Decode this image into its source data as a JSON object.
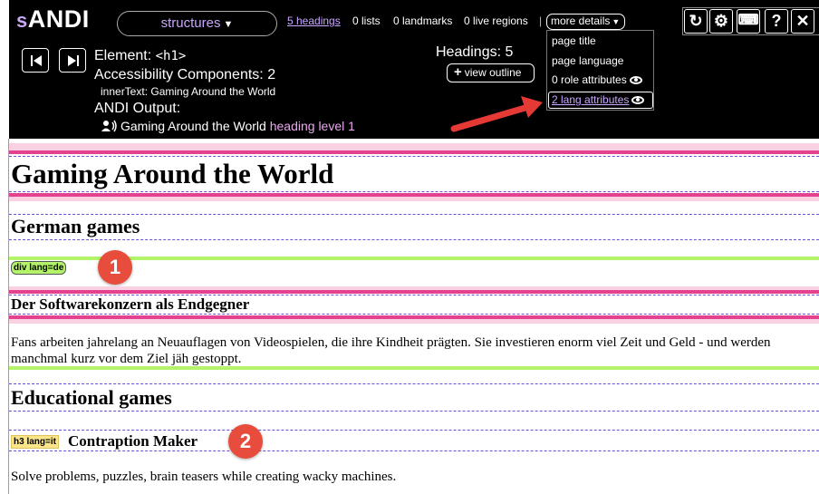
{
  "toolbar": {
    "logo_s": "s",
    "logo_rest": "ANDI",
    "mode": "structures",
    "headings_link": "5 headings",
    "lists": "0 lists",
    "landmarks": "0 landmarks",
    "live_regions": "0 live regions",
    "separator": "|",
    "more_details": "more details",
    "dropdown": {
      "page_title": "page title",
      "page_language": "page language",
      "role_attributes": "0 role attributes",
      "lang_attributes": "2 lang attributes"
    },
    "buttons": {
      "refresh": "↻",
      "settings": "⚙",
      "keyboard": "⌨",
      "help": "?",
      "close": "✕"
    },
    "element_label": "Element:",
    "element_tag": "<h1>",
    "components": "Accessibility Components: 2",
    "inner_text": "innerText: Gaming Around the World",
    "andi_output_label": "ANDI Output:",
    "output_text": "Gaming Around the World",
    "output_level": "heading level 1",
    "headings_count": "Headings: 5",
    "view_outline": "view outline",
    "plus": "+"
  },
  "content": {
    "h1": "Gaming Around the World",
    "h2_german": "German games",
    "div_lang_tag": "div lang=de",
    "h3_german": "Der Softwarekonzern als Endgegner",
    "para_german": "Fans arbeiten jahrelang an Neuauflagen von Videospielen, die ihre Kindheit prägten. Sie investieren enorm viel Zeit und Geld - und werden manchmal kurz vor dem Ziel jäh gestoppt.",
    "h2_educational": "Educational games",
    "h3_lang_tag": "h3 lang=it",
    "h3_contraption": "Contraption Maker",
    "para_contraption": "Solve problems, puzzles, brain teasers while creating wacky machines."
  },
  "annotations": {
    "badge_1": "1",
    "badge_2": "2"
  },
  "colors": {
    "toolbar_bg": "#000000",
    "link_purple": "#c8a6ff",
    "heading_pink": "#e4418f",
    "lang_green": "#b3f46a",
    "lang_yellow": "#fbe58a",
    "badge_red": "#e74c3c"
  }
}
